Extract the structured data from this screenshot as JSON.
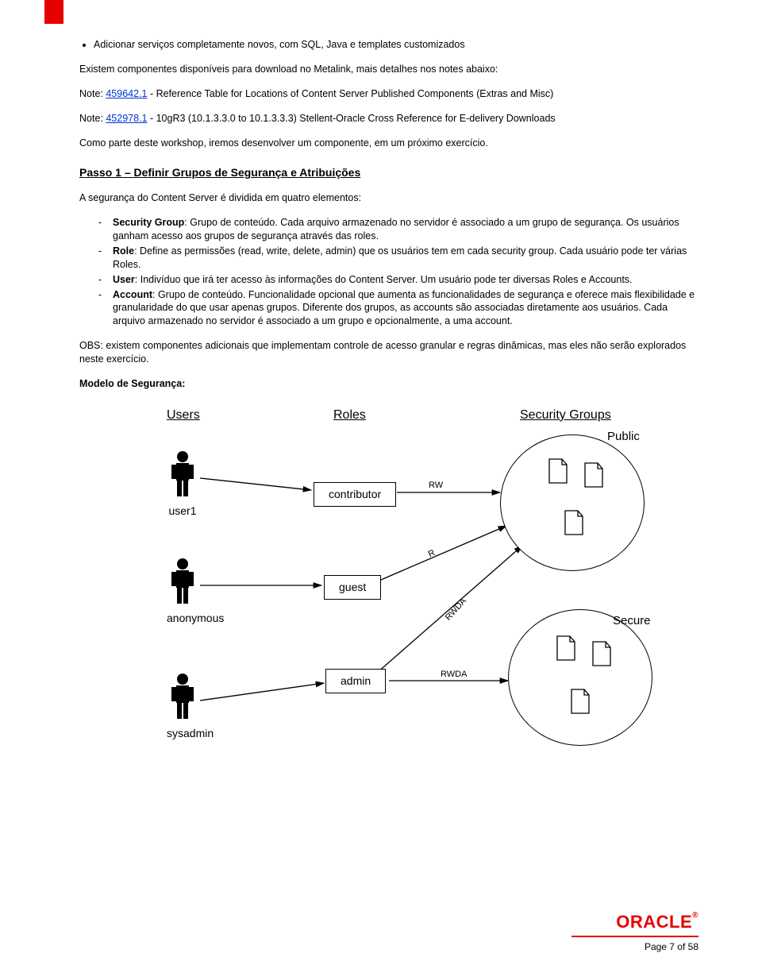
{
  "bullet1": "Adicionar serviços completamente novos, com SQL, Java e templates customizados",
  "intro1": "Existem componentes disponíveis para download no Metalink, mais detalhes nos notes abaixo:",
  "note1_prefix": "Note: ",
  "note1_link": "459642.1",
  "note1_suffix": " - Reference Table for Locations of Content Server Published Components (Extras and Misc)",
  "note2_prefix": "Note: ",
  "note2_link": "452978.1",
  "note2_suffix": " - 10gR3 (10.1.3.3.0 to 10.1.3.3.3) Stellent-Oracle Cross Reference for E-delivery Downloads",
  "workshop_line": "Como parte deste workshop, iremos desenvolver um componente, em um próximo exercício.",
  "step_title": "Passo 1 – Definir Grupos de Segurança e Atribuições",
  "sec_intro": "A segurança do Content Server é dividida em quatro elementos:",
  "defs": {
    "sg_b": "Security Group",
    "sg_t": ": Grupo de conteúdo. Cada arquivo armazenado no servidor é associado a um grupo de segurança. Os usuários ganham acesso aos grupos de segurança através das roles.",
    "role_b": "Role",
    "role_t": ": Define as permissões (read, write, delete, admin) que os usuários tem em cada security group. Cada usuário pode ter várias Roles.",
    "user_b": "User",
    "user_t": ": Indivíduo que irá ter acesso às informações do Content Server. Um usuário pode ter diversas Roles e Accounts.",
    "acc_b": "Account",
    "acc_t": ": Grupo de conteúdo. Funcionalidade opcional que aumenta as funcionalidades de segurança e oferece mais flexibilidade e granularidade do que usar apenas grupos.  Diferente dos grupos, as accounts são associadas diretamente aos usuários. Cada arquivo armazenado no servidor é associado a um grupo e opcionalmente, a uma account."
  },
  "obs": "OBS: existem componentes adicionais que implementam controle de acesso granular e regras dinâmicas, mas eles não serão explorados neste exercício.",
  "model_title": "Modelo de Segurança:",
  "diagram": {
    "col_users": "Users",
    "col_roles": "Roles",
    "col_groups": "Security Groups",
    "user1": "user1",
    "anon": "anonymous",
    "sys": "sysadmin",
    "role_contrib": "contributor",
    "role_guest": "guest",
    "role_admin": "admin",
    "grp_public": "Public",
    "grp_secure": "Secure",
    "perm_rw": "RW",
    "perm_r": "R",
    "perm_rwda1": "RWDA",
    "perm_rwda2": "RWDA"
  },
  "footer": {
    "brand": "ORACLE",
    "page": "Page 7 of 58"
  }
}
